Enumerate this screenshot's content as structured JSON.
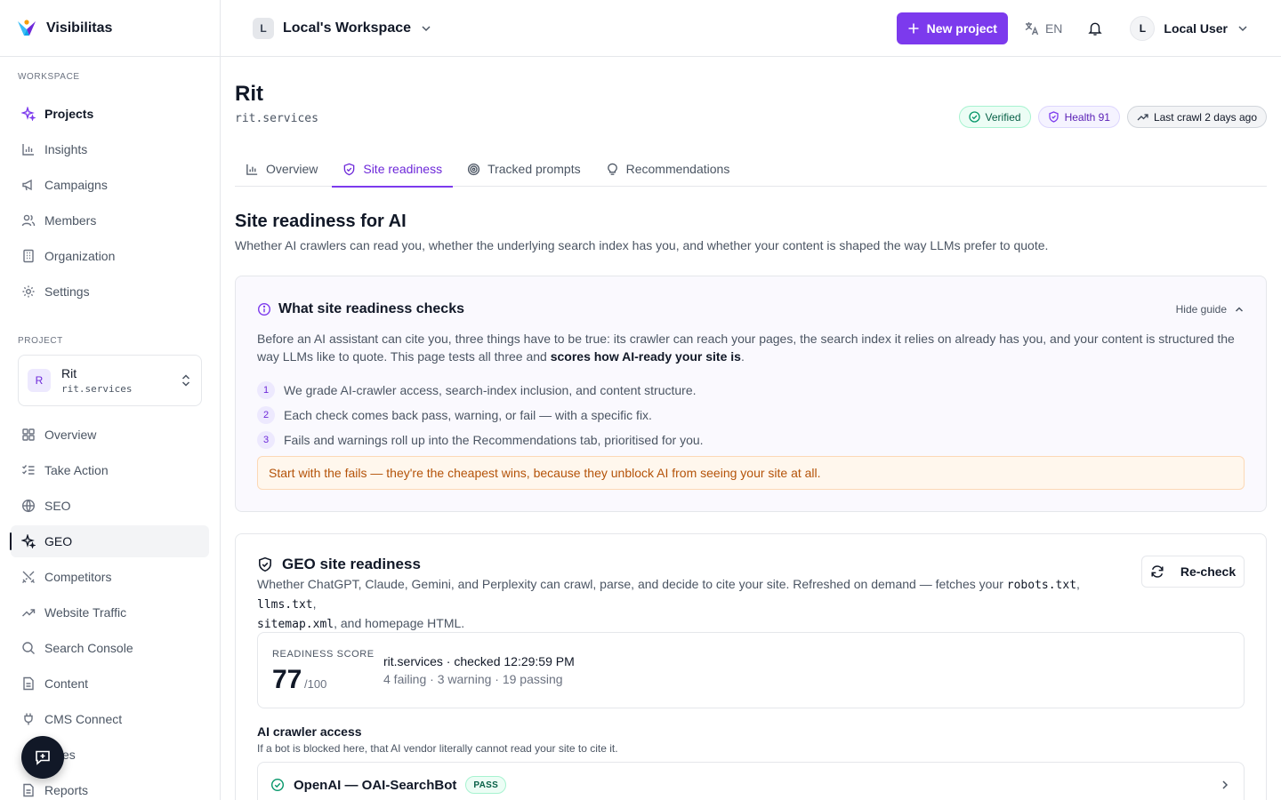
{
  "brand": {
    "name": "Visibilitas"
  },
  "sidebar": {
    "workspace_label": "WORKSPACE",
    "workspace_items": [
      {
        "label": "Projects",
        "icon": "sparkles-icon"
      },
      {
        "label": "Insights",
        "icon": "bar-chart-icon"
      },
      {
        "label": "Campaigns",
        "icon": "megaphone-icon"
      },
      {
        "label": "Members",
        "icon": "users-icon"
      },
      {
        "label": "Organization",
        "icon": "building-icon"
      },
      {
        "label": "Settings",
        "icon": "gear-icon"
      }
    ],
    "project_label": "PROJECT",
    "project_card": {
      "initial": "R",
      "name": "Rit",
      "domain": "rit.services"
    },
    "project_items": [
      {
        "label": "Overview",
        "icon": "grid-icon"
      },
      {
        "label": "Take Action",
        "icon": "checklist-icon"
      },
      {
        "label": "SEO",
        "icon": "globe-icon"
      },
      {
        "label": "GEO",
        "icon": "sparkles-icon"
      },
      {
        "label": "Competitors",
        "icon": "swords-icon"
      },
      {
        "label": "Website Traffic",
        "icon": "trend-up-icon"
      },
      {
        "label": "Search Console",
        "icon": "search-icon"
      },
      {
        "label": "Content",
        "icon": "file-icon"
      },
      {
        "label": "CMS Connect",
        "icon": "plug-icon"
      },
      {
        "label": "es",
        "icon": "file-icon"
      },
      {
        "label": "Reports",
        "icon": "file-icon"
      }
    ]
  },
  "header": {
    "workspace_initial": "L",
    "workspace_name": "Local's Workspace",
    "new_project": "New project",
    "language": "EN",
    "user_initial": "L",
    "user_name": "Local User"
  },
  "page": {
    "title": "Rit",
    "domain": "rit.services",
    "badges": {
      "verified": "Verified",
      "health": "Health 91",
      "last_crawl": "Last crawl 2 days ago"
    },
    "tabs": [
      "Overview",
      "Site readiness",
      "Tracked prompts",
      "Recommendations"
    ],
    "active_tab": "Site readiness",
    "section_title": "Site readiness for AI",
    "section_sub": "Whether AI crawlers can read you, whether the underlying search index has you, and whether your content is shaped the way LLMs prefer to quote."
  },
  "guide": {
    "title": "What site readiness checks",
    "hide": "Hide guide",
    "text_before": "Before an AI assistant can cite you, three things have to be true: its crawler can reach your pages, the search index it relies on already has you, and your content is structured the way LLMs like to quote. This page tests all three and ",
    "text_bold": "scores how AI-ready your site is",
    "text_after": ".",
    "steps": [
      {
        "num": "1",
        "text": "We grade AI-crawler access, search-index inclusion, and content structure."
      },
      {
        "num": "2",
        "text": "Each check comes back pass, warning, or fail — with a specific fix."
      },
      {
        "num": "3",
        "text": "Fails and warnings roll up into the Recommendations tab, prioritised for you."
      }
    ],
    "tip": "Start with the fails — they're the cheapest wins, because they unblock AI from seeing your site at all."
  },
  "geo": {
    "title": "GEO site readiness",
    "desc_1": "Whether ChatGPT, Claude, Gemini, and Perplexity can crawl, parse, and decide to cite your site. Refreshed on demand — fetches your ",
    "file_1": "robots.txt",
    "sep_1": ", ",
    "file_2": "llms.txt",
    "sep_2": ",",
    "file_3": "sitemap.xml",
    "desc_2": ", and homepage HTML.",
    "recheck": "Re-check",
    "score_label": "READINESS SCORE",
    "score": "77",
    "score_max": "/100",
    "checked": "rit.services · checked 12:29:59 PM",
    "counts": "4 failing · 3 warning · 19 passing",
    "crawler_title": "AI crawler access",
    "crawler_sub": "If a bot is blocked here, that AI vendor literally cannot read your site to cite it.",
    "rows": [
      {
        "name": "OpenAI — OAI-SearchBot",
        "status": "PASS"
      }
    ]
  },
  "colors": {
    "accent": "#7c3aed",
    "pass": "#059669",
    "warning": "#b45309"
  }
}
